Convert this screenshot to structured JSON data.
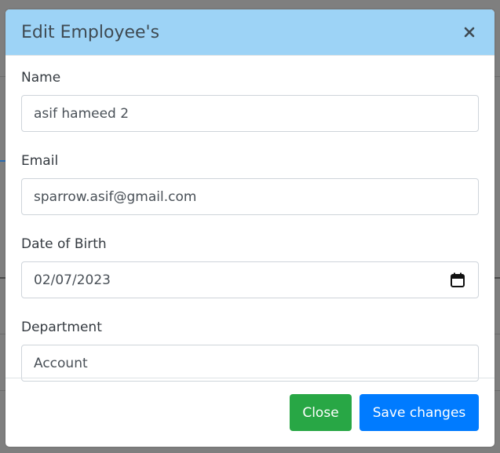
{
  "modal": {
    "title": "Edit Employee's",
    "close_icon": "close-icon"
  },
  "form": {
    "fields": [
      {
        "label": "Name",
        "value": "asif hameed 2"
      },
      {
        "label": "Email",
        "value": "sparrow.asif@gmail.com"
      },
      {
        "label": "Date of Birth",
        "value": "02/07/2023",
        "icon": "calendar-icon"
      },
      {
        "label": "Department",
        "value": "Account"
      }
    ]
  },
  "footer": {
    "close_label": "Close",
    "save_label": "Save changes"
  },
  "colors": {
    "header_bg": "#9dd3f6",
    "close_button": "#28a745",
    "save_button": "#007bff"
  }
}
